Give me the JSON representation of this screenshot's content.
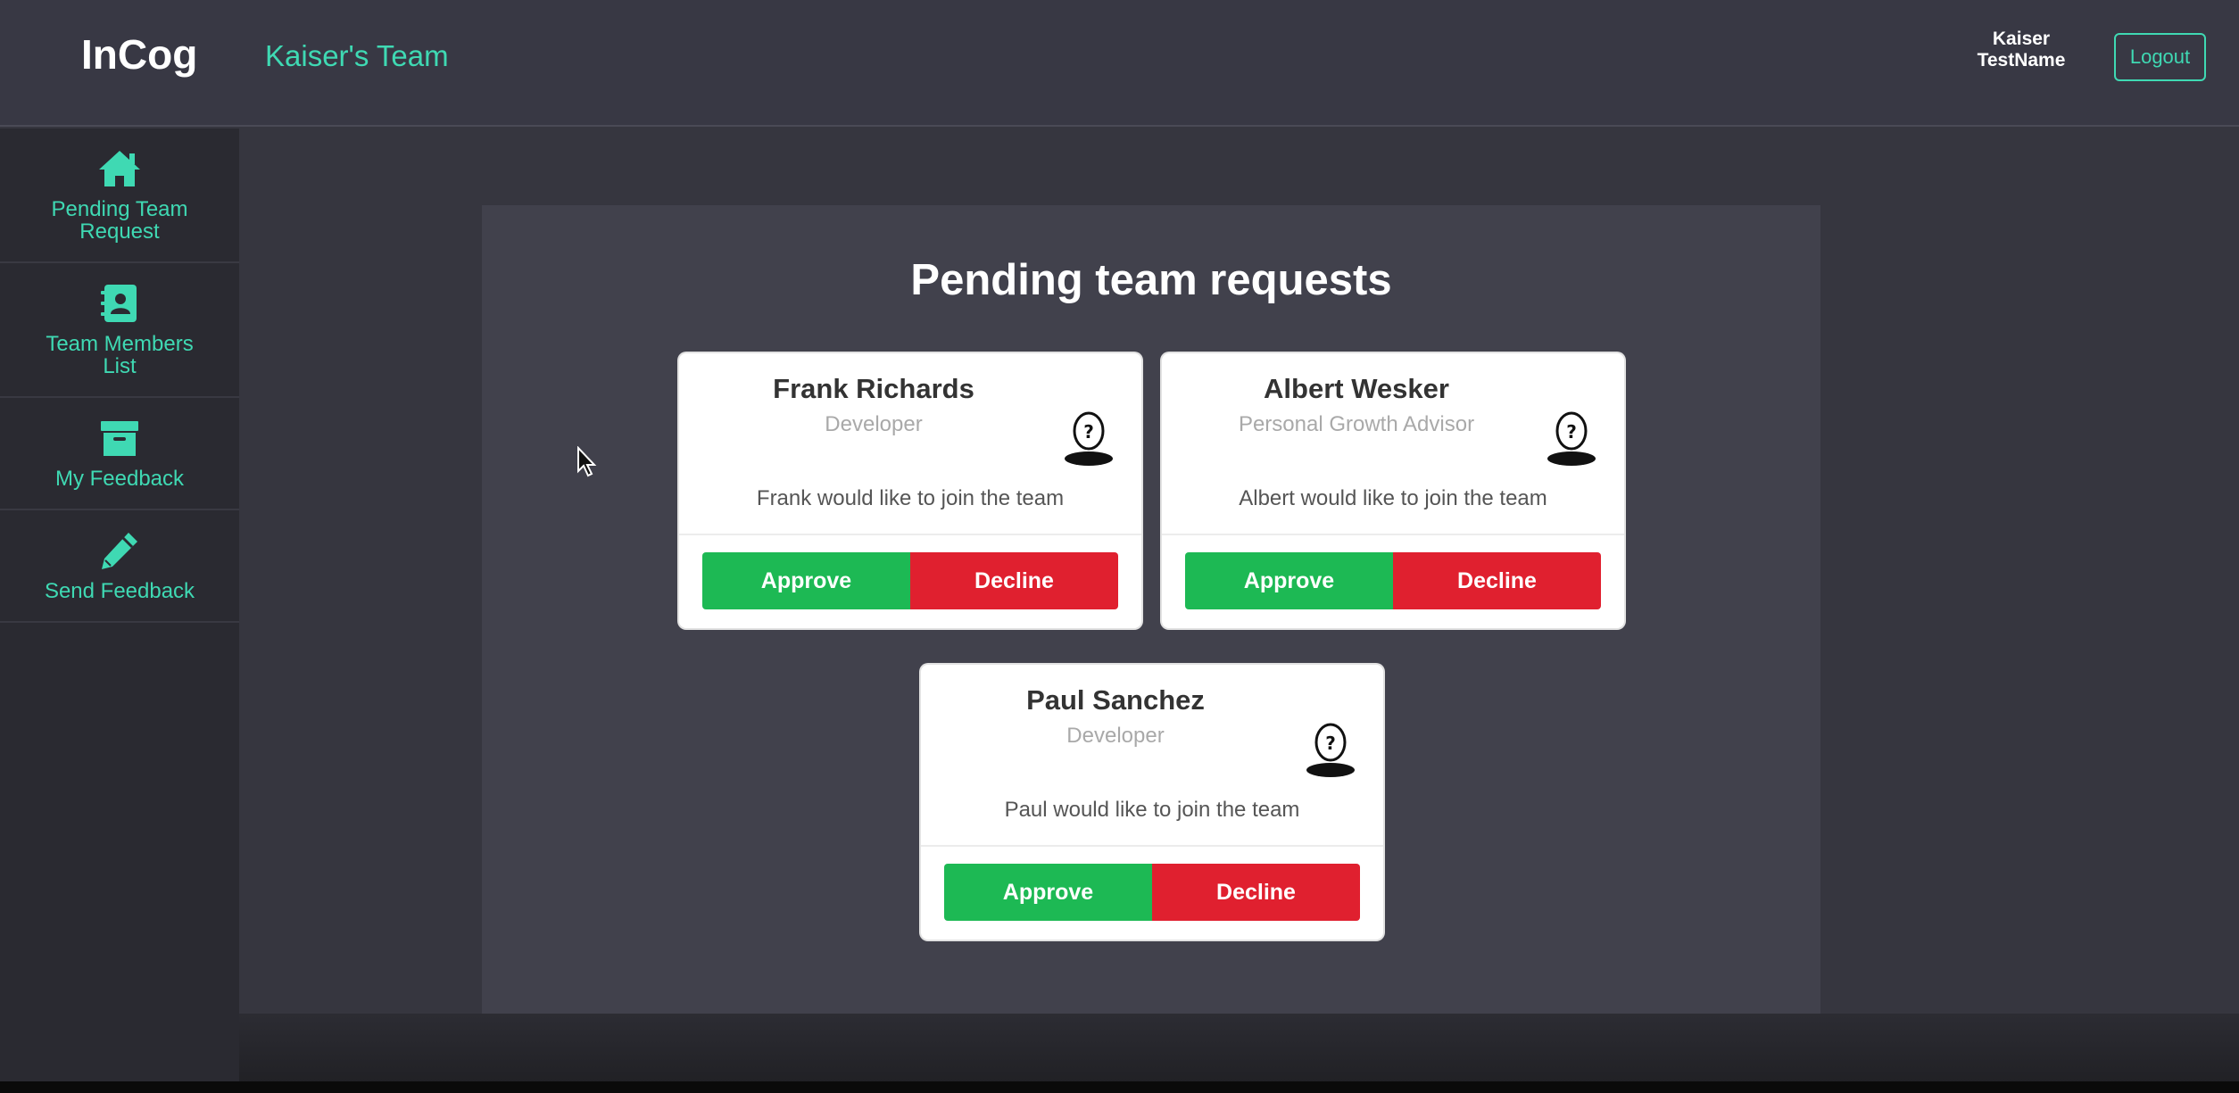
{
  "header": {
    "brand": "InCog",
    "team_name": "Kaiser's Team",
    "user_first": "Kaiser",
    "user_last": "TestName",
    "logout_label": "Logout"
  },
  "sidebar": {
    "items": [
      {
        "label": "Pending Team Request",
        "icon": "home-icon"
      },
      {
        "label": "Team Members List",
        "icon": "contact-book-icon"
      },
      {
        "label": "My Feedback",
        "icon": "archive-box-icon"
      },
      {
        "label": "Send Feedback",
        "icon": "pencil-icon"
      }
    ]
  },
  "main": {
    "title": "Pending team requests",
    "requests": [
      {
        "name": "Frank Richards",
        "role": "Developer",
        "message": "Frank would like to join the team",
        "approve_label": "Approve",
        "decline_label": "Decline"
      },
      {
        "name": "Albert Wesker",
        "role": "Personal Growth Advisor",
        "message": "Albert would like to join the team",
        "approve_label": "Approve",
        "decline_label": "Decline"
      },
      {
        "name": "Paul Sanchez",
        "role": "Developer",
        "message": "Paul would like to join the team",
        "approve_label": "Approve",
        "decline_label": "Decline"
      }
    ]
  },
  "colors": {
    "accent": "#3fd9b3",
    "approve": "#1db954",
    "decline": "#e0202f",
    "background": "#36363f",
    "sidebar": "#2a2a31",
    "panel": "#41414c"
  }
}
